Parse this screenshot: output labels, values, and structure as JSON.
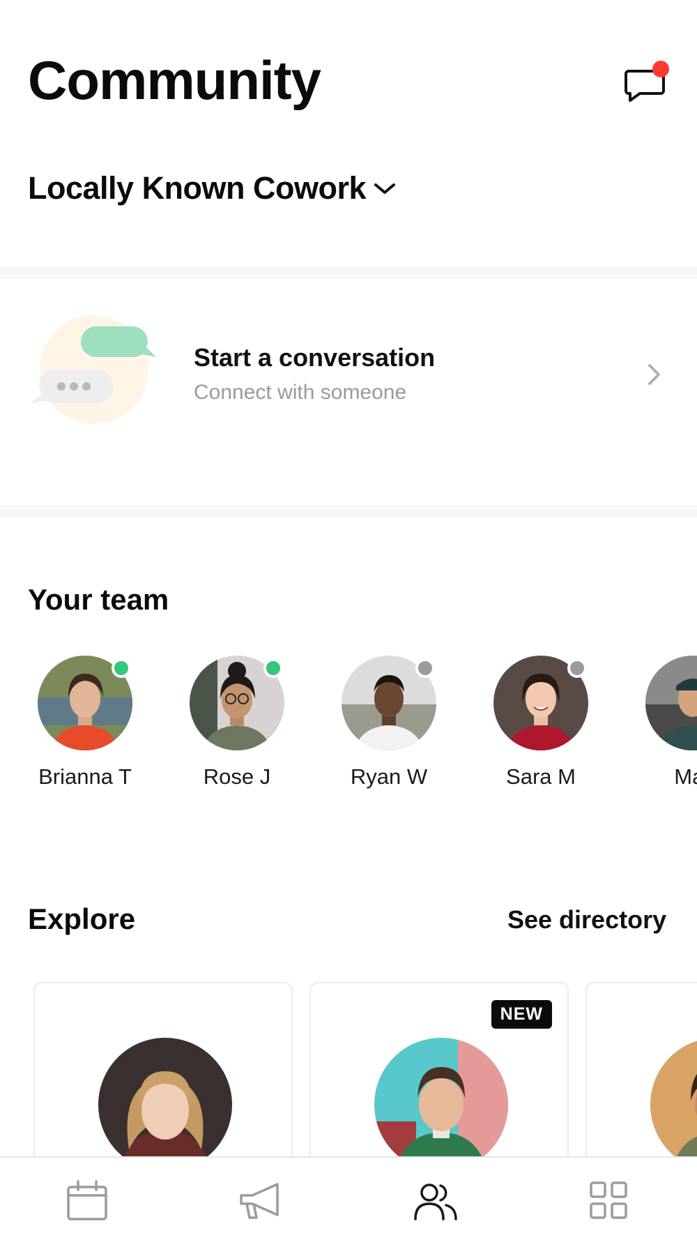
{
  "header": {
    "title": "Community",
    "workspace": "Locally Known Cowork",
    "chat_badge_color": "#ff3b30"
  },
  "conversation": {
    "title": "Start a conversation",
    "subtitle": "Connect with someone"
  },
  "team": {
    "title": "Your team",
    "members": [
      {
        "name": "Brianna T",
        "status": "online"
      },
      {
        "name": "Rose J",
        "status": "online"
      },
      {
        "name": "Ryan W",
        "status": "offline"
      },
      {
        "name": "Sara M",
        "status": "offline"
      },
      {
        "name": "Mar",
        "status": "none"
      }
    ]
  },
  "explore": {
    "title": "Explore",
    "link": "See directory",
    "cards": [
      {
        "badge": ""
      },
      {
        "badge": "NEW"
      },
      {
        "badge": ""
      }
    ]
  },
  "colors": {
    "online": "#34c77b",
    "offline": "#9b9b9b",
    "accent_text": "#0b0b0b"
  },
  "tabs": [
    {
      "icon": "calendar-icon",
      "active": false
    },
    {
      "icon": "megaphone-icon",
      "active": false
    },
    {
      "icon": "people-icon",
      "active": true
    },
    {
      "icon": "grid-icon",
      "active": false
    }
  ]
}
